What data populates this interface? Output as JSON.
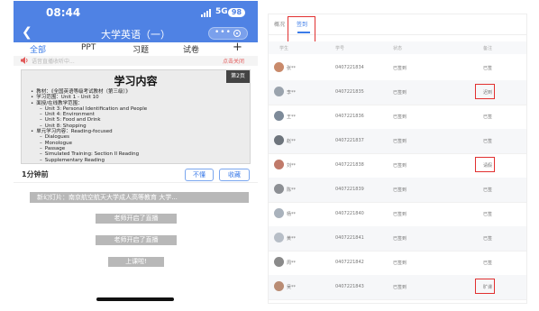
{
  "phone": {
    "status": {
      "time": "08:44",
      "network": "5G",
      "battery": "98"
    },
    "title": "大学英语（一）",
    "capsule": {
      "more_icon": "more-dots-icon",
      "close_icon": "close-circle-icon"
    },
    "tabs": [
      "全部",
      "PPT",
      "习题",
      "试卷",
      "+"
    ],
    "notice": {
      "text": "语音直播收听中...",
      "link": "点击关闭"
    },
    "slide": {
      "title": "学习内容",
      "page": "第2页",
      "lines": [
        {
          "kind": "main",
          "text": "教材：《全国英语等级考试教材（第三级）》"
        },
        {
          "kind": "main",
          "text": "学习范围：Unit 1 - Unit 10"
        },
        {
          "kind": "main",
          "text": "面授/在线教学范围："
        },
        {
          "kind": "sub",
          "text": "Unit 3: Personal Identification and People"
        },
        {
          "kind": "sub",
          "text": "Unit 4: Environment"
        },
        {
          "kind": "sub",
          "text": "Unit 5: Food and Drink"
        },
        {
          "kind": "sub",
          "text": "Unit 8: Shopping"
        },
        {
          "kind": "main",
          "text": "单元学习内容：Reading-focused"
        },
        {
          "kind": "sub",
          "text": "Dialogues"
        },
        {
          "kind": "sub",
          "text": "Monologue"
        },
        {
          "kind": "sub",
          "text": "Passage"
        },
        {
          "kind": "sub",
          "text": "Simulated Training: Section II Reading"
        },
        {
          "kind": "sub",
          "text": "Supplementary Reading"
        }
      ]
    },
    "meta": {
      "time_ago": "1分钟前",
      "btn_not_understand": "不懂",
      "btn_collect": "收藏"
    },
    "new_slide": "新幻灯片：南京航空航天大学成人高等教育 大学...",
    "events": [
      "老师开启了直播",
      "老师开启了直播",
      "上课啦!"
    ]
  },
  "panel": {
    "tabs": [
      "概况",
      "签到"
    ],
    "headers": [
      "学生",
      "学号",
      "状态",
      "备注"
    ],
    "rows": [
      {
        "name": "张**",
        "id": "0407221834",
        "status": "已签到",
        "remark": "已签"
      },
      {
        "name": "李**",
        "id": "0407221835",
        "status": "已签到",
        "remark": "迟到"
      },
      {
        "name": "王**",
        "id": "0407221836",
        "status": "已签到",
        "remark": "已签"
      },
      {
        "name": "赵**",
        "id": "0407221837",
        "status": "已签到",
        "remark": "已签"
      },
      {
        "name": "刘**",
        "id": "0407221838",
        "status": "已签到",
        "remark": "请假"
      },
      {
        "name": "陈**",
        "id": "0407221839",
        "status": "已签到",
        "remark": "已签"
      },
      {
        "name": "杨**",
        "id": "0407221840",
        "status": "已签到",
        "remark": "已签"
      },
      {
        "name": "黄**",
        "id": "0407221841",
        "status": "已签到",
        "remark": "已签"
      },
      {
        "name": "周**",
        "id": "0407221842",
        "status": "已签到",
        "remark": "已签"
      },
      {
        "name": "吴**",
        "id": "0407221843",
        "status": "已签到",
        "remark": "旷课"
      }
    ],
    "colors": {
      "accent": "#3b7be8",
      "highlight": "#e13030"
    }
  }
}
